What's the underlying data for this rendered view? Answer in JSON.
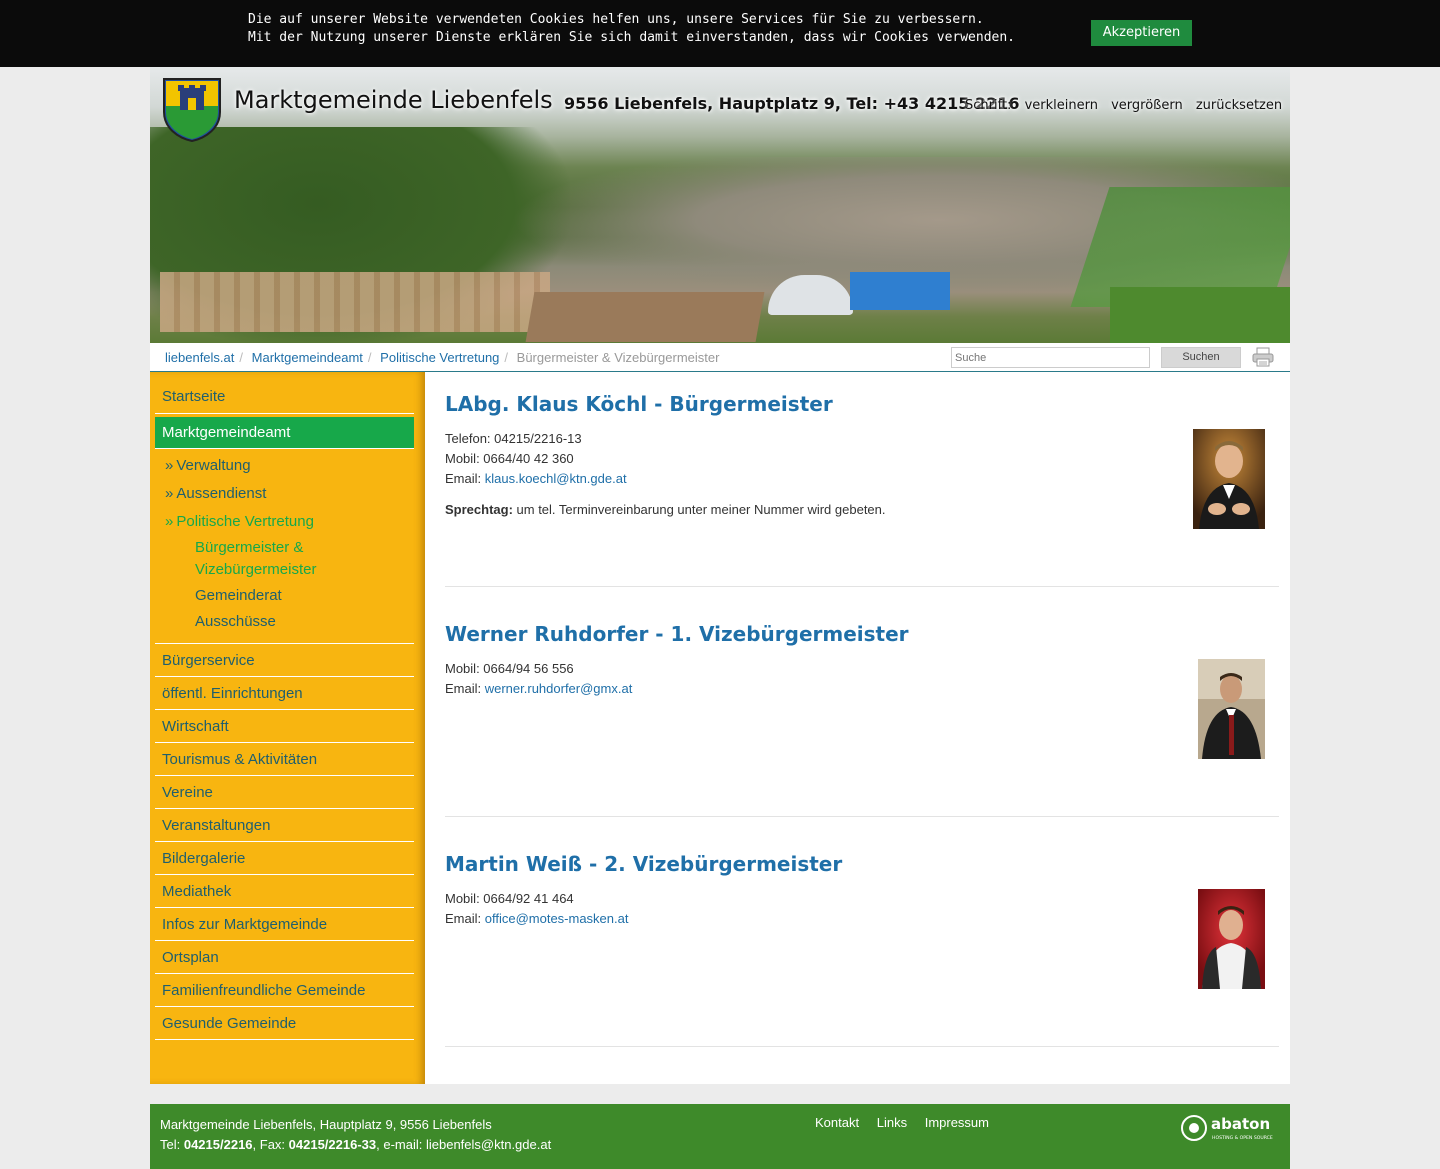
{
  "cookie": {
    "line1": "Die auf unserer Website verwendeten Cookies helfen uns, unsere Services für Sie zu verbessern.",
    "line2": "Mit der Nutzung unserer Dienste erklären Sie sich damit einverstanden, dass wir Cookies verwenden.",
    "accept": "Akzeptieren"
  },
  "header": {
    "title": "Marktgemeinde Liebenfels",
    "address": "9556 Liebenfels, Hauptplatz 9, Tel: +43 4215 2216",
    "font_label": "Schrift:",
    "font_smaller": "verkleinern",
    "font_bigger": "vergrößern",
    "font_reset": "zurücksetzen"
  },
  "breadcrumb": [
    "liebenfels.at",
    "Marktgemeindeamt",
    "Politische Vertretung",
    "Bürgermeister & Vizebürgermeister"
  ],
  "search": {
    "placeholder": "Suche",
    "button": "Suchen"
  },
  "nav": {
    "startseite": "Startseite",
    "marktgemeindeamt": "Marktgemeindeamt",
    "sub": [
      "Verwaltung",
      "Aussendienst",
      "Politische Vertretung"
    ],
    "subsub": [
      "Bürgermeister & Vizebürgermeister",
      "Gemeinderat",
      "Ausschüsse"
    ],
    "rest": [
      "Bürgerservice",
      "öffentl. Einrichtungen",
      "Wirtschaft",
      "Tourismus & Aktivitäten",
      "Vereine",
      "Veranstaltungen",
      "Bildergalerie",
      "Mediathek",
      "Infos zur Marktgemeinde",
      "Ortsplan",
      "Familienfreundliche Gemeinde",
      "Gesunde Gemeinde"
    ]
  },
  "people": [
    {
      "name": "LAbg. Klaus Köchl - Bürgermeister",
      "phone": "Telefon: 04215/2216-13",
      "mobile": "Mobil: 0664/40 42 360",
      "email_label": "Email: ",
      "email": "klaus.koechl@ktn.gde.at",
      "sprechtag_label": "Sprechtag:",
      "sprechtag": " um tel. Terminvereinbarung unter meiner Nummer wird gebeten."
    },
    {
      "name": "Werner Ruhdorfer - 1. Vizebürgermeister",
      "mobile": "Mobil: 0664/94 56 556",
      "email_label": "Email: ",
      "email": "werner.ruhdorfer@gmx.at"
    },
    {
      "name": "Martin Weiß - 2. Vizebürgermeister",
      "mobile": "Mobil: 0664/92 41 464",
      "email_label": "Email: ",
      "email": "office@motes-masken.at"
    }
  ],
  "footer": {
    "line1": "Marktgemeinde Liebenfels, Hauptplatz 9, 9556 Liebenfels",
    "tel_label": "Tel: ",
    "tel": "04215/2216",
    "fax_label": ", Fax: ",
    "fax": "04215/2216-33",
    "email_label": ", e-mail: ",
    "email": "liebenfels@ktn.gde.at",
    "links": [
      "Kontakt",
      "Links",
      "Impressum"
    ],
    "brand": "abaton",
    "brand_sub": "HOSTING & OPEN SOURCE"
  },
  "colors": {
    "accent_green": "#17a84a",
    "sidebar": "#f8b510",
    "link": "#1f6fa8",
    "footer": "#3e8a2a"
  }
}
